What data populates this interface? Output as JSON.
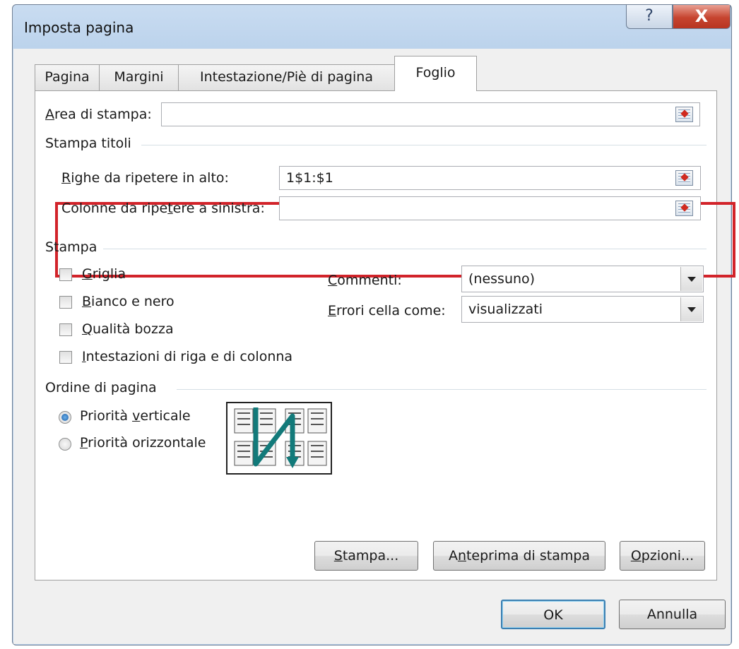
{
  "window": {
    "title": "Imposta pagina",
    "help": "?",
    "close": "X"
  },
  "tabs": [
    "Pagina",
    "Margini",
    "Intestazione/Piè di pagina",
    "Foglio"
  ],
  "print_area": {
    "label_u": "A",
    "label_rest": "rea di stampa:",
    "value": ""
  },
  "print_titles": {
    "section": "Stampa titoli",
    "rows_u": "R",
    "rows_rest": "ighe da ripetere in alto:",
    "rows_value": "1$1:$1",
    "cols_a": "Colonne da ripe",
    "cols_u": "t",
    "cols_b": "ere a sinistra:",
    "cols_value": ""
  },
  "print": {
    "section": "Stampa",
    "checks": [
      {
        "u": "G",
        "rest": "riglia"
      },
      {
        "u": "B",
        "rest": "ianco e nero"
      },
      {
        "u": "Q",
        "rest": "ualità bozza"
      },
      {
        "u": "I",
        "rest": "ntestazioni di riga e di colonna"
      }
    ],
    "comments_u": "C",
    "comments_rest": "ommenti:",
    "comments_value": "(nessuno)",
    "errors_u": "E",
    "errors_rest": "rrori cella come:",
    "errors_value": "visualizzati"
  },
  "order": {
    "section": "Ordine di pagina",
    "down_a": "Priorità ",
    "down_u": "v",
    "down_b": "erticale",
    "over_u": "P",
    "over_rest": "riorità orizzontale",
    "selected": "down"
  },
  "buttons": {
    "print_u": "S",
    "print_rest": "tampa...",
    "preview_a": "A",
    "preview_u": "n",
    "preview_b": "teprima di stampa",
    "options_u": "O",
    "options_rest": "pzioni...",
    "ok": "OK",
    "cancel": "Annulla"
  }
}
